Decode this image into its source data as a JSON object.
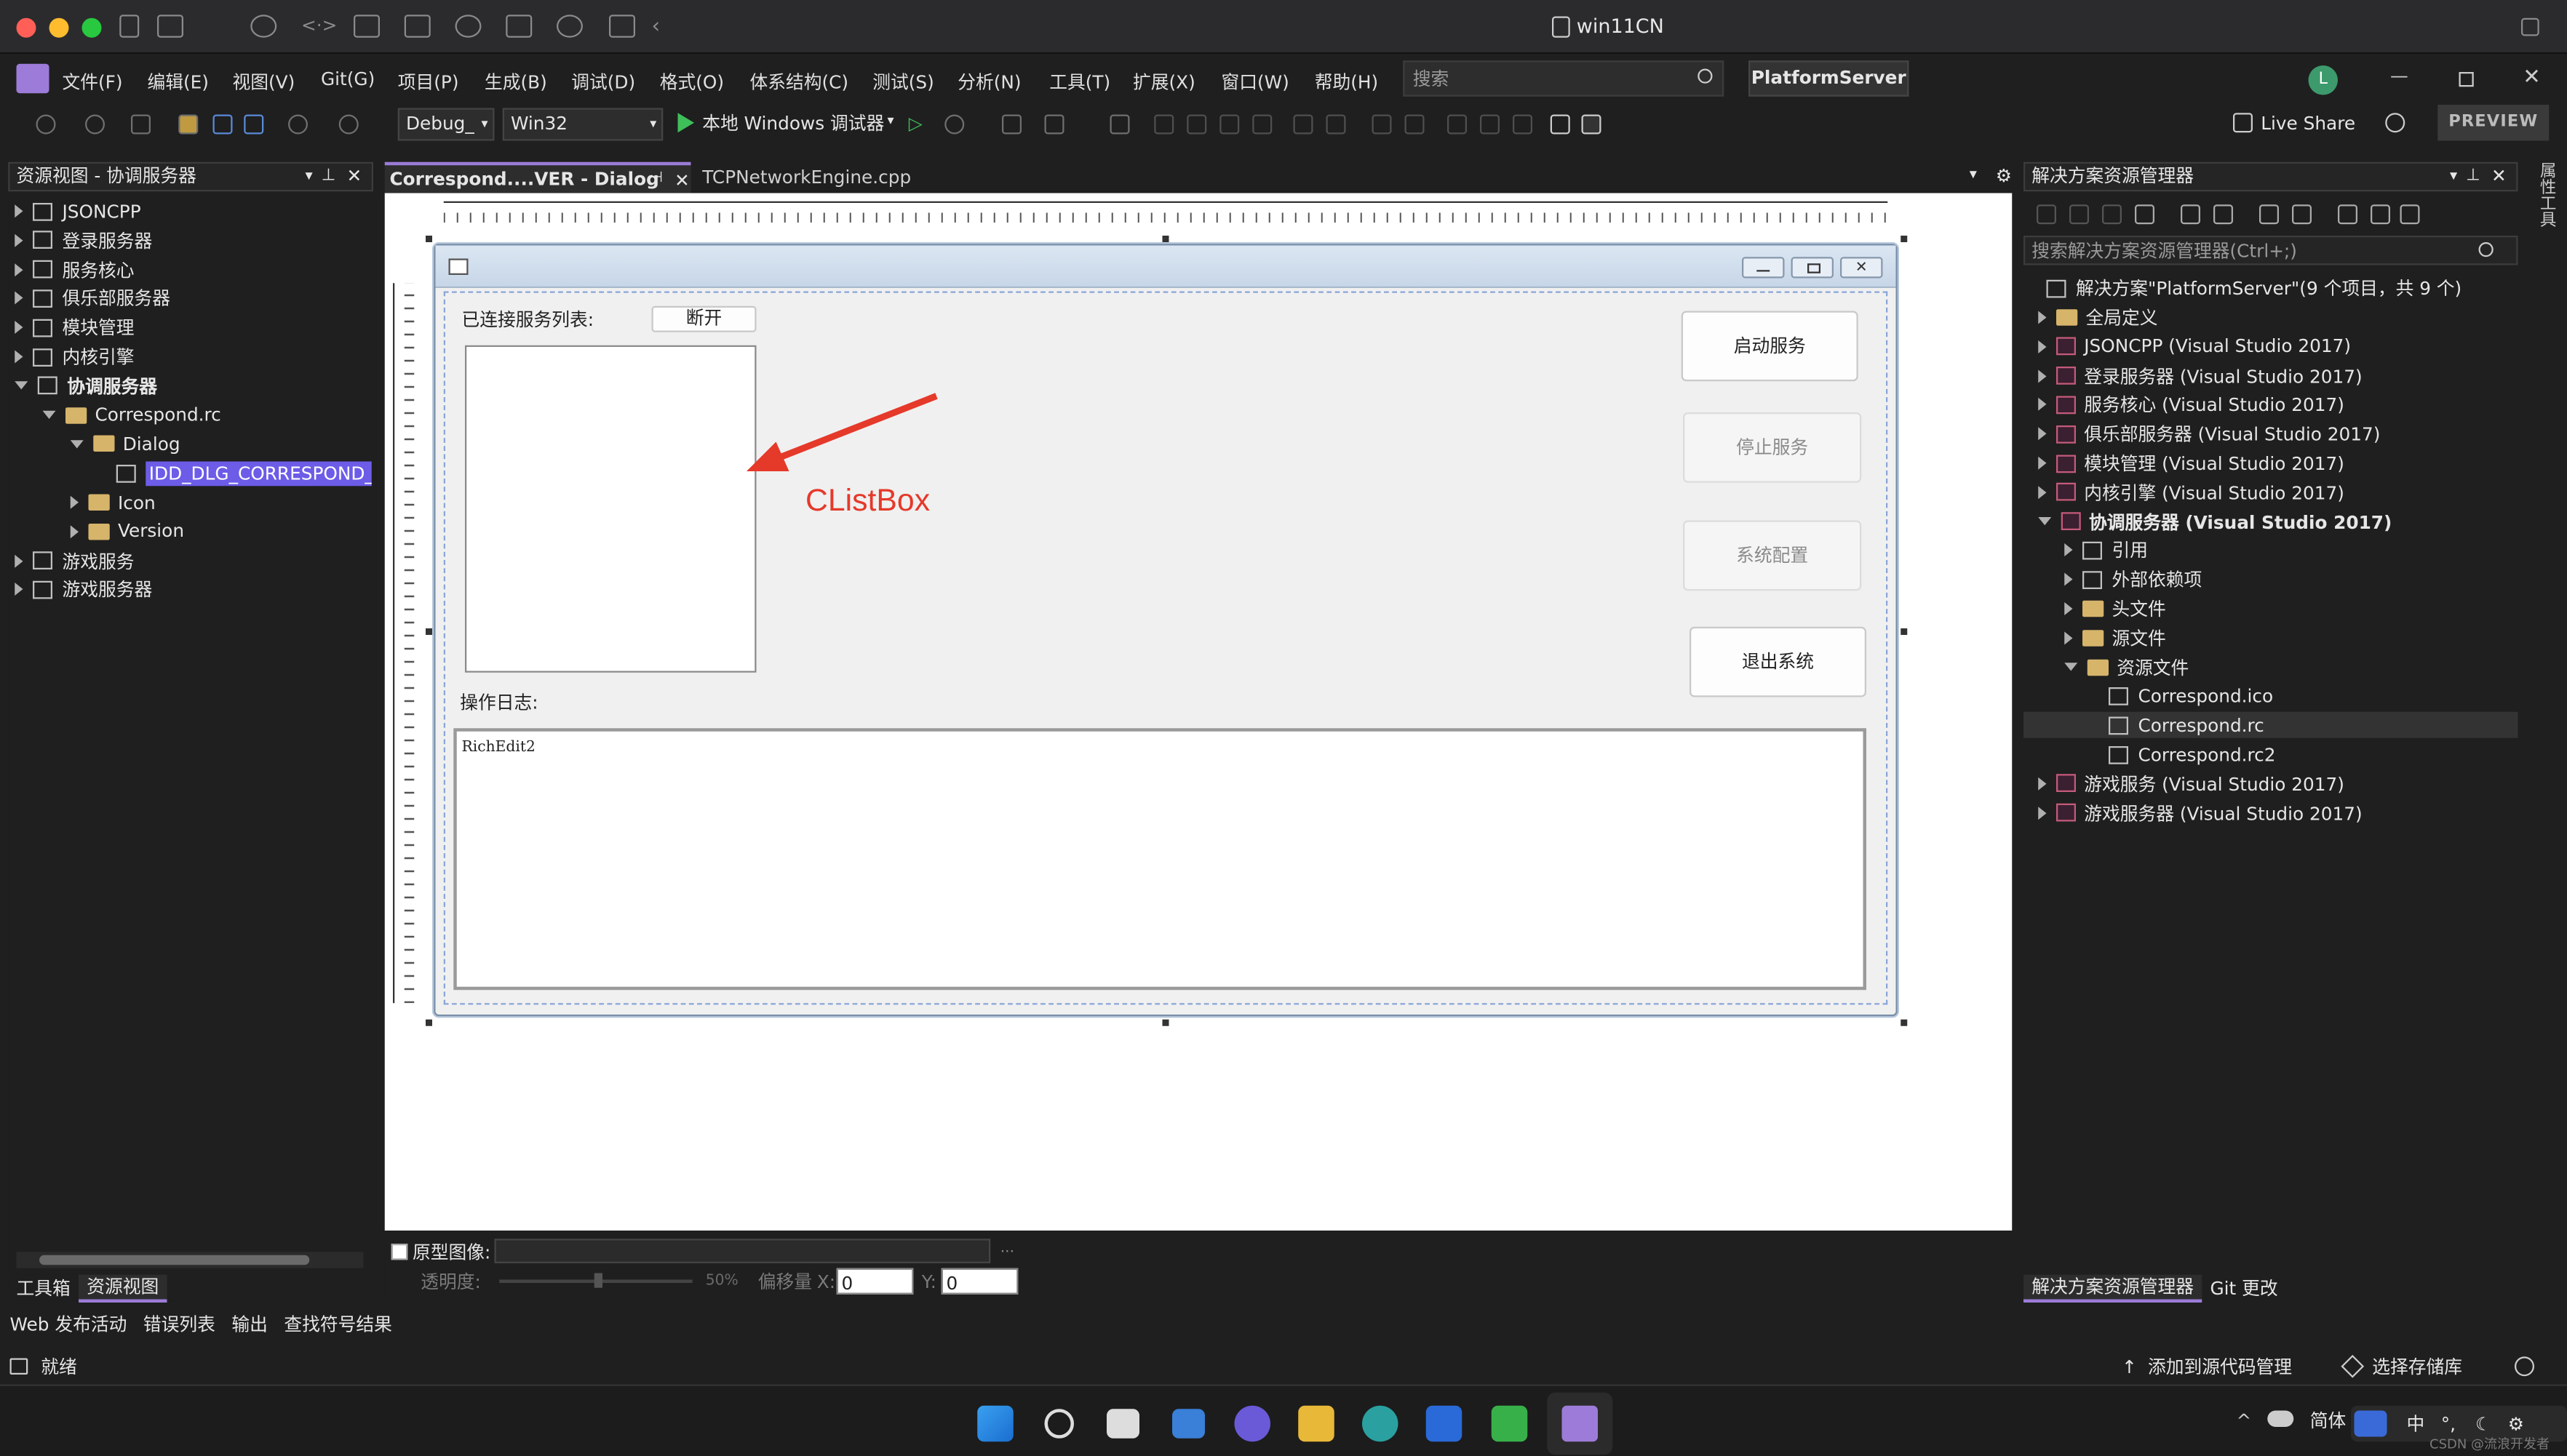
{
  "window": {
    "title": "win11CN"
  },
  "menu": [
    "文件(F)",
    "编辑(E)",
    "视图(V)",
    "Git(G)",
    "项目(P)",
    "生成(B)",
    "调试(D)",
    "格式(O)",
    "体系结构(C)",
    "测试(S)",
    "分析(N)",
    "工具(T)",
    "扩展(X)",
    "窗口(W)",
    "帮助(H)"
  ],
  "search": {
    "placeholder": "搜索"
  },
  "solution_name": "PlatformServer",
  "user_initial": "L",
  "toolbar": {
    "config": "Debug_",
    "platform": "Win32",
    "run_label": "本地 Windows 调试器",
    "live_share": "Live Share",
    "preview": "PREVIEW"
  },
  "left_panel": {
    "title": "资源视图 - 协调服务器",
    "items": [
      "JSONCPP",
      "登录服务器",
      "服务核心",
      "俱乐部服务器",
      "模块管理",
      "内核引擎",
      "协调服务器",
      "Correspond.rc",
      "Dialog",
      "IDD_DLG_CORRESPOND_SE",
      "Icon",
      "Version",
      "游戏服务",
      "游戏服务器"
    ],
    "bottom_tabs": [
      "工具箱",
      "资源视图"
    ]
  },
  "editor_tabs": [
    "Correspond....VER - Dialog",
    "TCPNetworkEngine.cpp"
  ],
  "dialog": {
    "list_label": "已连接服务列表:",
    "disconnect": "断开",
    "start": "启动服务",
    "stop": "停止服务",
    "config": "系统配置",
    "exit": "退出系统",
    "log_label": "操作日志:",
    "richedit": "RichEdit2"
  },
  "annotation": {
    "text": "CListBox",
    "color": "#e5392a"
  },
  "proto_bar": {
    "checkbox": "原型图像:",
    "opacity": "透明度:",
    "pct": "50%",
    "offset": "偏移量",
    "x_label": "X:",
    "x_val": "0",
    "y_label": "Y:",
    "y_val": "0"
  },
  "right_panel": {
    "title": "解决方案资源管理器",
    "search_placeholder": "搜索解决方案资源管理器(Ctrl+;)",
    "solution_line": "解决方案\"PlatformServer\"(9 个项目，共 9 个)",
    "items": [
      "全局定义",
      "JSONCPP (Visual Studio 2017)",
      "登录服务器 (Visual Studio 2017)",
      "服务核心 (Visual Studio 2017)",
      "俱乐部服务器 (Visual Studio 2017)",
      "模块管理 (Visual Studio 2017)",
      "内核引擎 (Visual Studio 2017)",
      "协调服务器 (Visual Studio 2017)",
      "引用",
      "外部依赖项",
      "头文件",
      "源文件",
      "资源文件",
      "Correspond.ico",
      "Correspond.rc",
      "Correspond.rc2",
      "游戏服务 (Visual Studio 2017)",
      "游戏服务器 (Visual Studio 2017)"
    ],
    "bottom_tabs": [
      "解决方案资源管理器",
      "Git 更改"
    ],
    "side_tab": "属性工具"
  },
  "output_tabs": [
    "Web 发布活动",
    "错误列表",
    "输出",
    "查找符号结果"
  ],
  "status": {
    "ready": "就绪",
    "source_control": "添加到源代码管理",
    "repo": "选择存储库"
  },
  "taskbar": {
    "ime": "简体",
    "ime2": "中",
    "watermark": "CSDN @流浪开发者"
  }
}
